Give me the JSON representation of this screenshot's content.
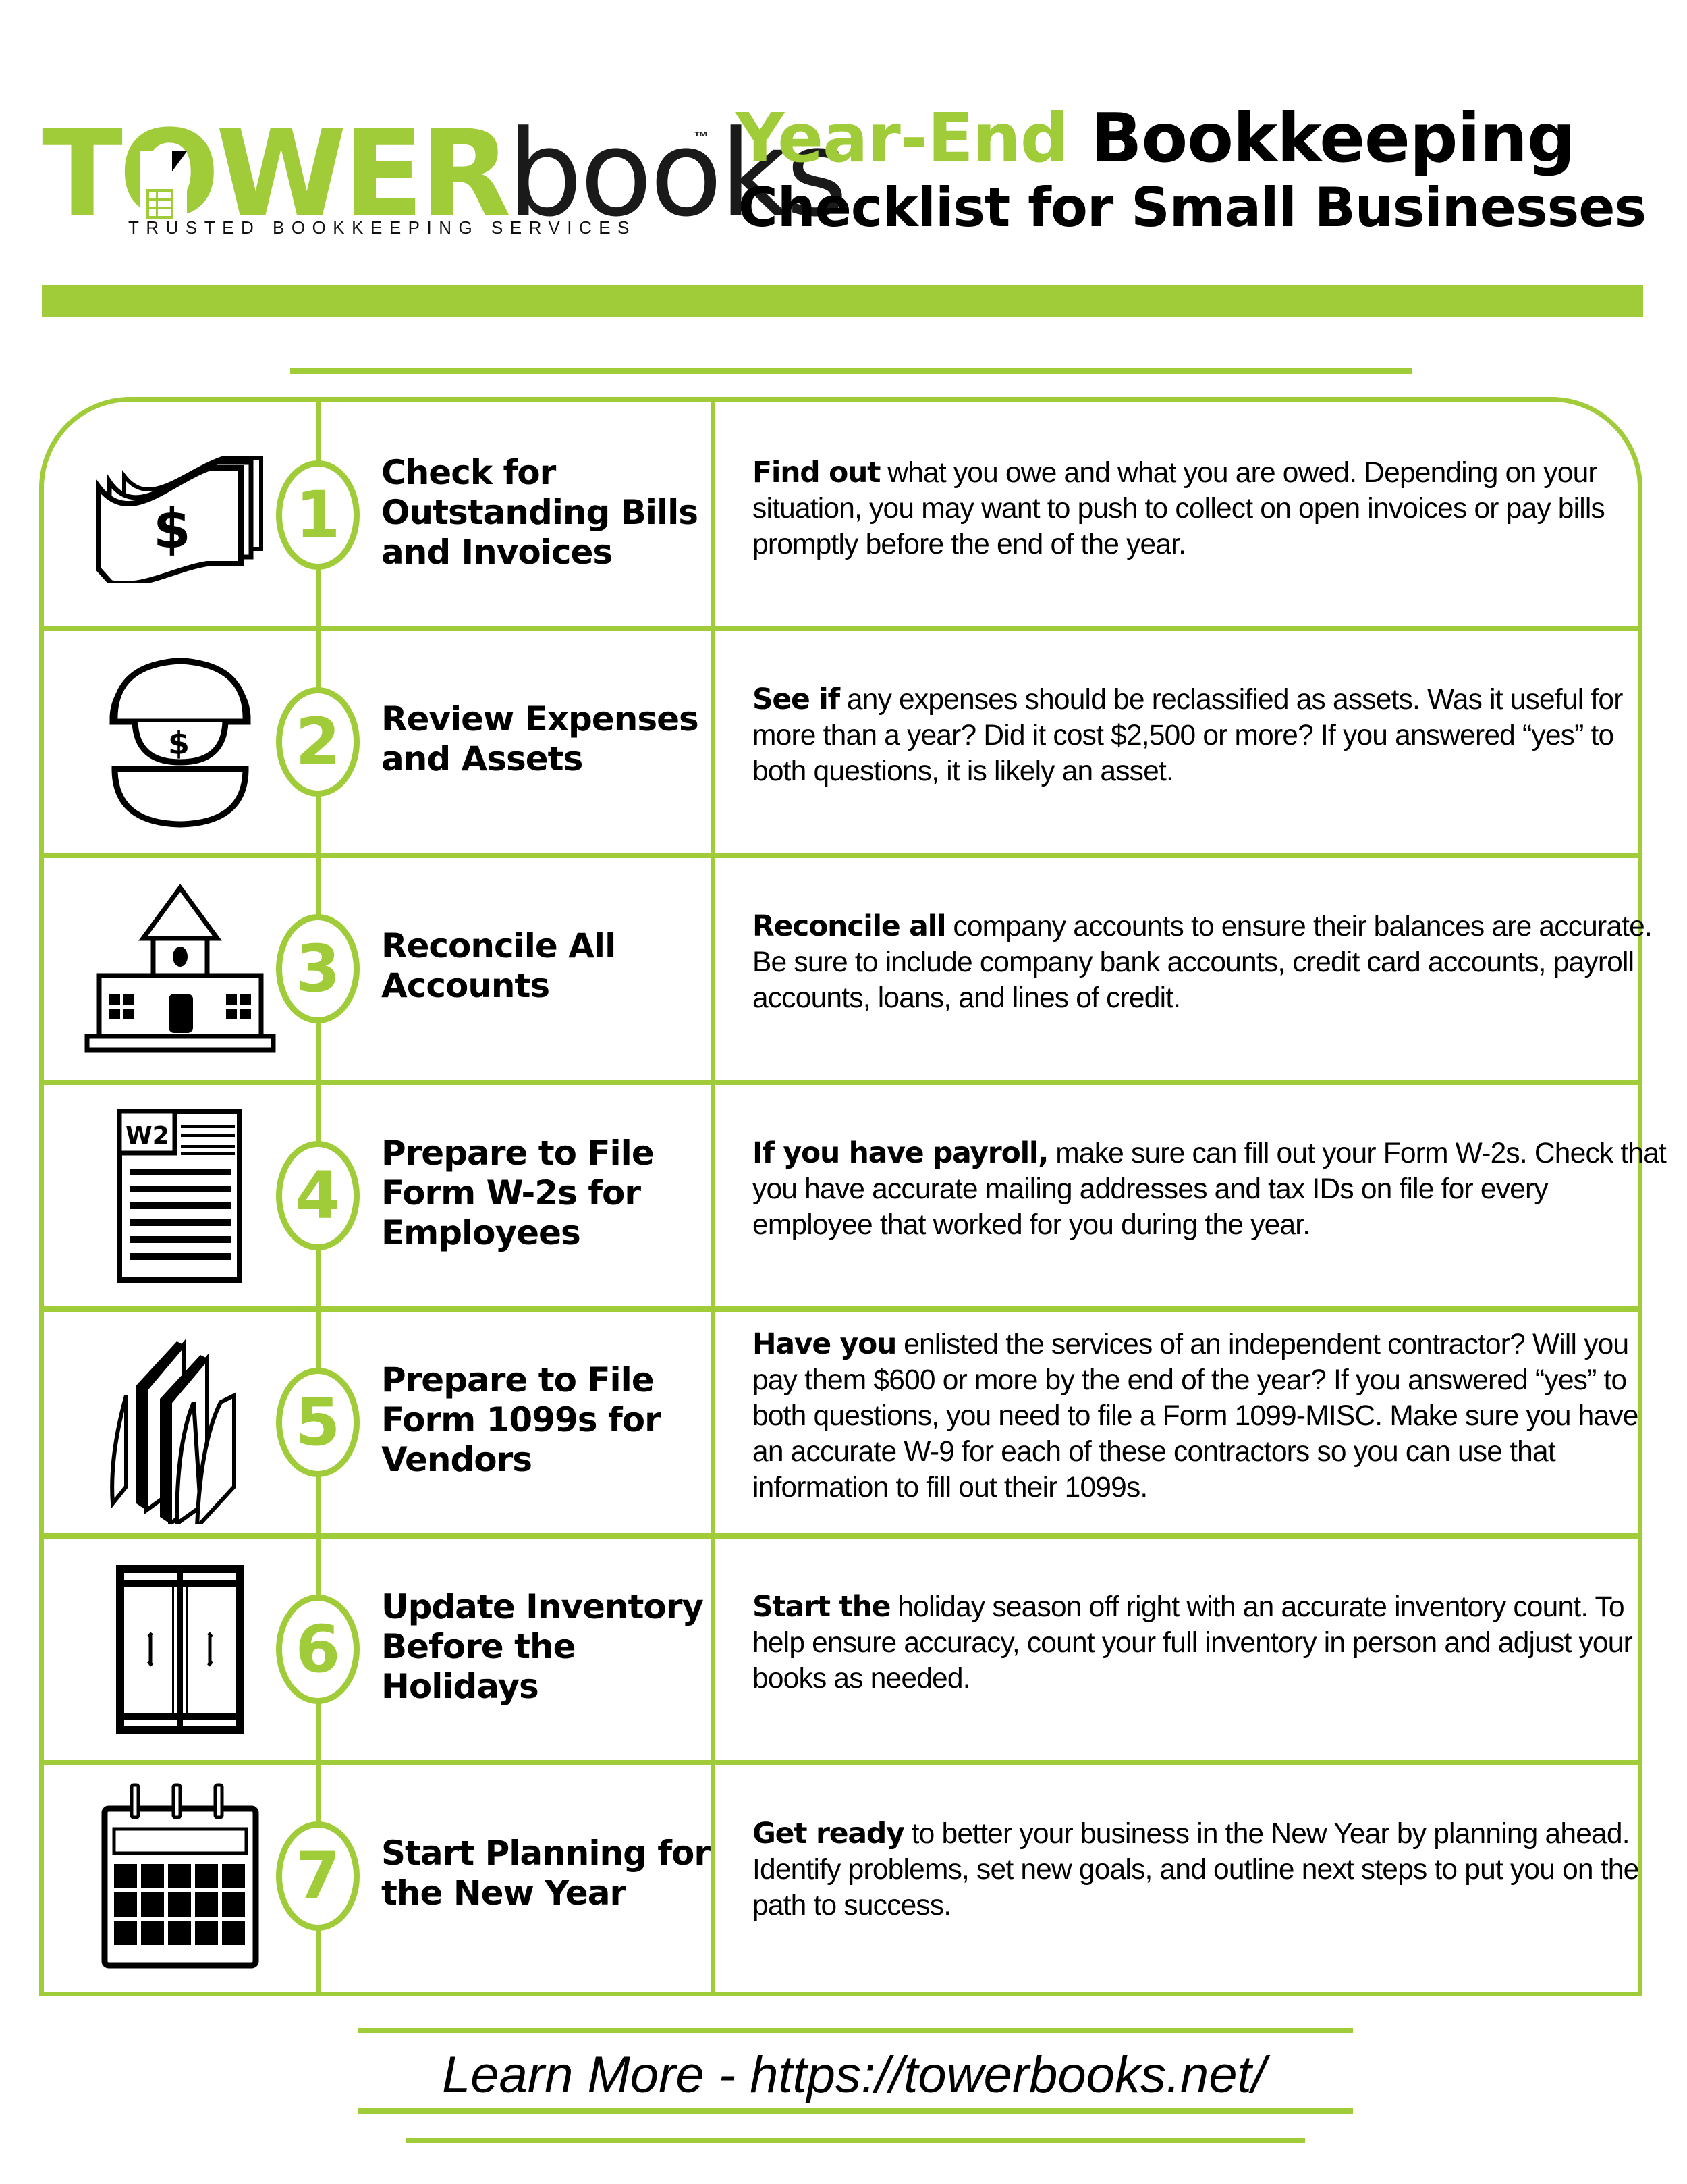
{
  "brand": {
    "logo_part1": "TOWER",
    "logo_part2": "books",
    "trademark": "™",
    "tagline": "TRUSTED BOOKKEEPING SERVICES",
    "accent_color": "#a0cc3a",
    "text_color": "#000000"
  },
  "header": {
    "title_green": "Year-End",
    "title_black": "Bookkeeping",
    "title_line2": "Checklist for Small Businesses"
  },
  "steps": [
    {
      "number": "1",
      "icon": "money-bills-icon",
      "title": "Check for\nOutstanding Bills\nand Invoices",
      "desc_bold": "Find out",
      "desc_rest": " what you owe and what you are owed. Depending on your situation, you may want to push to collect on open invoices or pay bills promptly before the end of the year."
    },
    {
      "number": "2",
      "icon": "coin-capsule-icon",
      "title": "Review Expenses\nand Assets",
      "desc_bold": "See if",
      "desc_rest": " any expenses should be reclassified as assets. Was it useful for more than a year? Did it cost $2,500 or more? If you answered “yes” to both questions, it is likely an asset."
    },
    {
      "number": "3",
      "icon": "bank-building-icon",
      "title": "Reconcile All\nAccounts",
      "desc_bold": "Reconcile all",
      "desc_rest": " company accounts to ensure their balances are accurate. Be sure to include company bank accounts, credit card accounts, payroll accounts, loans, and lines of credit."
    },
    {
      "number": "4",
      "icon": "w2-form-icon",
      "icon_label": "W2",
      "title": "Prepare to File\nForm W-2s for\nEmployees",
      "desc_bold": "If you have payroll,",
      "desc_rest": " make sure can fill out your Form W-2s. Check that you have accurate mailing addresses and tax IDs on file for every employee that worked for you during the year."
    },
    {
      "number": "5",
      "icon": "file-folders-icon",
      "title": "Prepare to File\nForm 1099s for\nVendors",
      "desc_bold": "Have you",
      "desc_rest": " enlisted the services of an independent contractor? Will you pay them $600 or more by the end of the year? If you answered “yes” to both questions, you need to file a Form 1099-MISC. Make sure you have an accurate W-9 for each of these contractors so you can use that information to fill out their 1099s."
    },
    {
      "number": "6",
      "icon": "storage-cabinet-icon",
      "title": "Update Inventory\nBefore the\nHolidays",
      "desc_bold": "Start the",
      "desc_rest": " holiday season off right with an accurate inventory count. To help ensure accuracy, count your full inventory in person and adjust your books as needed."
    },
    {
      "number": "7",
      "icon": "calendar-icon",
      "title": "Start Planning for\nthe New Year",
      "desc_bold": "Get ready",
      "desc_rest": " to better your business in the New Year by planning ahead. Identify problems, set new goals, and outline next steps to put you on the path to success."
    }
  ],
  "footer": {
    "label": "Learn More - ",
    "url": "https://towerbooks.net/"
  }
}
